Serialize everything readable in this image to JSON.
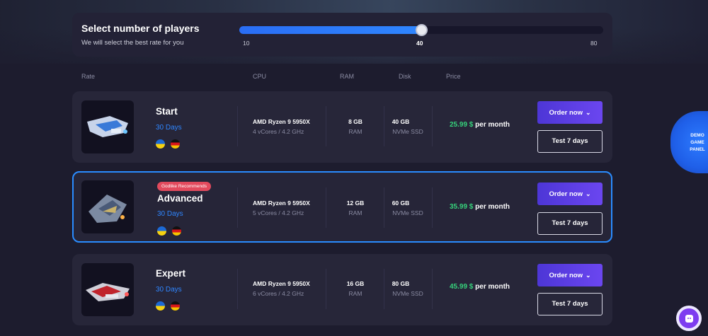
{
  "slider": {
    "title": "Select number of players",
    "subtitle": "We will select the best rate for you",
    "min_label": "10",
    "current_label": "40",
    "max_label": "80",
    "fill_fraction": 0.5
  },
  "columns": {
    "rate": "Rate",
    "cpu": "CPU",
    "ram": "RAM",
    "disk": "Disk",
    "price": "Price"
  },
  "plans": [
    {
      "name": "Start",
      "days": "30 Days",
      "badge": "",
      "cpu_name": "AMD Ryzen 9 5950X",
      "cpu_sub": "4 vCores / 4.2 GHz",
      "ram_val": "8 GB",
      "ram_sub": "RAM",
      "disk_val": "40 GB",
      "disk_sub": "NVMe SSD",
      "price_amount": "25.99 $",
      "price_period": "per month",
      "order_label": "Order now",
      "test_label": "Test 7 days"
    },
    {
      "name": "Advanced",
      "days": "30 Days",
      "badge": "Godlike Recommends",
      "cpu_name": "AMD Ryzen 9 5950X",
      "cpu_sub": "5 vCores / 4.2 GHz",
      "ram_val": "12 GB",
      "ram_sub": "RAM",
      "disk_val": "60 GB",
      "disk_sub": "NVMe SSD",
      "price_amount": "35.99 $",
      "price_period": "per month",
      "order_label": "Order now",
      "test_label": "Test 7 days"
    },
    {
      "name": "Expert",
      "days": "30 Days",
      "badge": "",
      "cpu_name": "AMD Ryzen 9 5950X",
      "cpu_sub": "6 vCores / 4.2 GHz",
      "ram_val": "16 GB",
      "ram_sub": "RAM",
      "disk_val": "80 GB",
      "disk_sub": "NVMe SSD",
      "price_amount": "45.99 $",
      "price_period": "per month",
      "order_label": "Order now",
      "test_label": "Test 7 days"
    }
  ],
  "demo_tab": {
    "line1": "DEMO",
    "line2": "GAME",
    "line3": "PANEL"
  },
  "colors": {
    "accent_blue": "#2f86ff",
    "price_green": "#36d17b",
    "order_purple": "#5a3ee0",
    "badge_red": "#e24a5d"
  }
}
